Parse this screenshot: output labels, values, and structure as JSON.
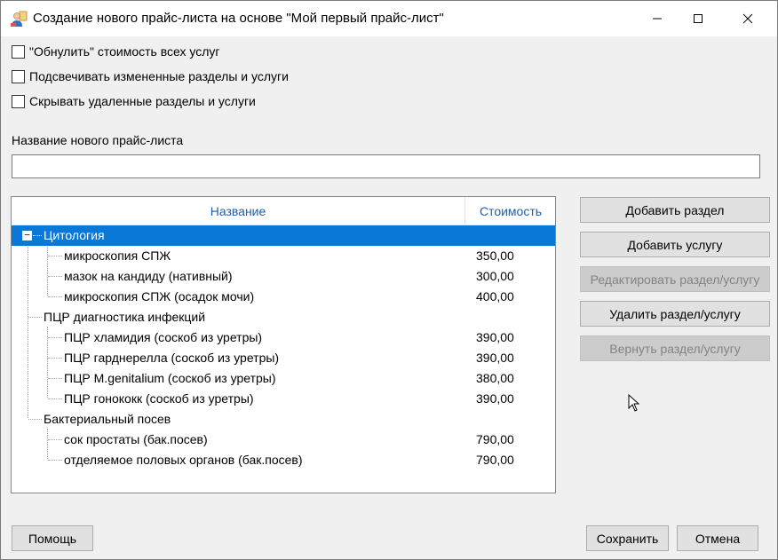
{
  "window": {
    "title": "Создание нового прайс-листа на основе \"Мой первый прайс-лист\""
  },
  "options": [
    {
      "label": "\"Обнулить\" стоимость всех услуг",
      "checked": false
    },
    {
      "label": "Подсвечивать измененные разделы и услуги",
      "checked": false
    },
    {
      "label": "Скрывать удаленные разделы и услуги",
      "checked": false
    }
  ],
  "new_name": {
    "label": "Название нового прайс-листа",
    "value": ""
  },
  "tree": {
    "headers": {
      "name": "Название",
      "price": "Стоимость"
    },
    "sections": [
      {
        "name": "Цитология",
        "selected": true,
        "items": [
          {
            "name": "микроскопия СПЖ",
            "price": "350,00"
          },
          {
            "name": "мазок на кандиду (нативный)",
            "price": "300,00"
          },
          {
            "name": "микроскопия СПЖ (осадок мочи)",
            "price": "400,00"
          }
        ]
      },
      {
        "name": "ПЦР диагностика инфекций",
        "selected": false,
        "items": [
          {
            "name": "ПЦР хламидия (соскоб из уретры)",
            "price": "390,00"
          },
          {
            "name": "ПЦР гарднерелла (соскоб из уретры)",
            "price": "390,00"
          },
          {
            "name": "ПЦР M.genitalium (соскоб из уретры)",
            "price": "380,00"
          },
          {
            "name": "ПЦР гонококк (соскоб из уретры)",
            "price": "390,00"
          }
        ]
      },
      {
        "name": "Бактериальный посев",
        "selected": false,
        "items": [
          {
            "name": "сок простаты (бак.посев)",
            "price": "790,00"
          },
          {
            "name": "отделяемое половых органов (бак.посев)",
            "price": "790,00"
          }
        ]
      }
    ]
  },
  "actions": {
    "add_section": "Добавить раздел",
    "add_service": "Добавить услугу",
    "edit": "Редактировать раздел/услугу",
    "delete": "Удалить раздел/услугу",
    "restore": "Вернуть раздел/услугу"
  },
  "footer": {
    "help": "Помощь",
    "save": "Сохранить",
    "cancel": "Отмена"
  }
}
